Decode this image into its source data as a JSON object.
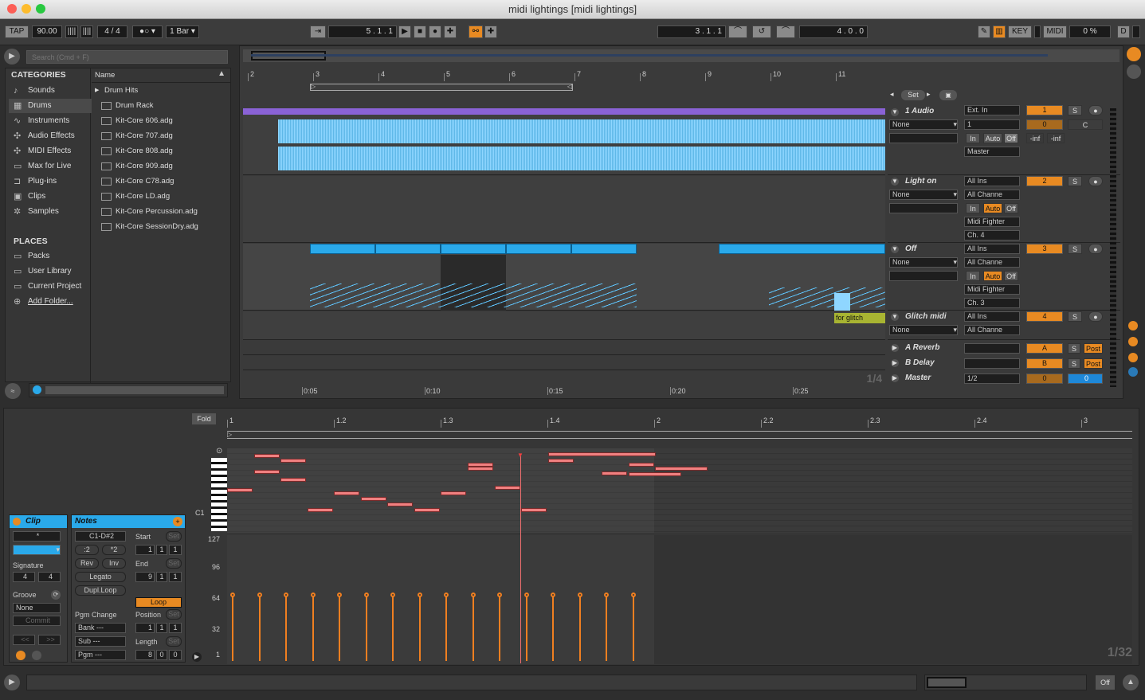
{
  "window": {
    "title": "midi lightings  [midi lightings]"
  },
  "toolbar": {
    "tap": "TAP",
    "tempo": "90.00",
    "sig_num": "4",
    "sig_sep": "/",
    "sig_den": "4",
    "quant": "1 Bar",
    "position": "5 .   1 .   1",
    "loop_start": "3 .   1 .   1",
    "loop_length": "4 .   0 .   0",
    "key": "KEY",
    "midi": "MIDI",
    "cpu": "0 %",
    "d": "D"
  },
  "browser": {
    "search_placeholder": "Search (Cmd + F)",
    "categories_title": "CATEGORIES",
    "categories": [
      {
        "label": "Sounds",
        "icon": "note-icon"
      },
      {
        "label": "Drums",
        "icon": "grid-icon"
      },
      {
        "label": "Instruments",
        "icon": "wave-icon"
      },
      {
        "label": "Audio Effects",
        "icon": "effect-icon"
      },
      {
        "label": "MIDI Effects",
        "icon": "midi-effect-icon"
      },
      {
        "label": "Max for Live",
        "icon": "max-icon"
      },
      {
        "label": "Plug-ins",
        "icon": "plugin-icon"
      },
      {
        "label": "Clips",
        "icon": "clip-icon"
      },
      {
        "label": "Samples",
        "icon": "sample-icon"
      }
    ],
    "places_title": "PLACES",
    "places": [
      {
        "label": "Packs"
      },
      {
        "label": "User Library"
      },
      {
        "label": "Current Project"
      },
      {
        "label": "Add Folder..."
      }
    ],
    "name_header": "Name",
    "parent_folder": "Drum Hits",
    "files": [
      "Drum Rack",
      "Kit-Core 606.adg",
      "Kit-Core 707.adg",
      "Kit-Core 808.adg",
      "Kit-Core 909.adg",
      "Kit-Core C78.adg",
      "Kit-Core LD.adg",
      "Kit-Core Percussion.adg",
      "Kit-Core SessionDry.adg"
    ]
  },
  "arrangement": {
    "bars": [
      "2",
      "3",
      "4",
      "5",
      "6",
      "7",
      "8",
      "9",
      "10",
      "11"
    ],
    "times": [
      "0:05",
      "0:10",
      "0:15",
      "0:20",
      "0:25"
    ],
    "set_label": "Set",
    "zoom": "1/4",
    "tracks": [
      {
        "name": "1 Audio",
        "in": "Ext. In",
        "in_ch": "1",
        "mon": [
          "In",
          "Auto",
          "Off"
        ],
        "out": "Master",
        "num": "1",
        "vol": "0",
        "pan": "C",
        "inf1": "-inf",
        "inf2": "-inf",
        "from": "None"
      },
      {
        "name": "Light on",
        "in": "All Ins",
        "in_ch": "All Channe",
        "mon": [
          "In",
          "Auto",
          "Off"
        ],
        "out": "Midi Fighter",
        "out_ch": "Ch. 4",
        "num": "2",
        "from": "None"
      },
      {
        "name": "Off",
        "in": "All Ins",
        "in_ch": "All Channe",
        "mon": [
          "In",
          "Auto",
          "Off"
        ],
        "out": "Midi Fighter",
        "out_ch": "Ch. 3",
        "num": "3",
        "from": "None"
      },
      {
        "name": "Glitch midi",
        "in": "All Ins",
        "in_ch": "All Channe",
        "num": "4",
        "from": "None",
        "clip": "for glitch"
      }
    ],
    "returns": [
      {
        "name": "A Reverb",
        "letter": "A",
        "post": "Post"
      },
      {
        "name": "B Delay",
        "letter": "B",
        "post": "Post"
      },
      {
        "name": "Master",
        "out": "1/2",
        "vol": "0",
        "pan": "0"
      }
    ],
    "solo": "S"
  },
  "clip_view": {
    "clip_title": "Clip",
    "notes_title": "Notes",
    "clip_name": "*",
    "signature_label": "Signature",
    "sig_num": "4",
    "sig_den": "4",
    "groove_label": "Groove",
    "groove_value": "None",
    "commit": "Commit",
    "pitch_range": "C1-D#2",
    "div2": ":2",
    "mul2": "*2",
    "rev": "Rev",
    "inv": "Inv",
    "legato": "Legato",
    "dupl": "Dupl.Loop",
    "pgm_change": "Pgm Change",
    "bank": "Bank ---",
    "sub": "Sub ---",
    "pgm": "Pgm ---",
    "start_label": "Start",
    "start": [
      "1",
      "1",
      "1"
    ],
    "end_label": "End",
    "end": [
      "9",
      "1",
      "1"
    ],
    "loop": "Loop",
    "position_label": "Position",
    "position": [
      "1",
      "1",
      "1"
    ],
    "length_label": "Length",
    "length": [
      "8",
      "0",
      "0"
    ],
    "set": "Set",
    "fold": "Fold",
    "ruler": [
      "1",
      "1.2",
      "1.3",
      "1.4",
      "2",
      "2.2",
      "2.3",
      "2.4",
      "3"
    ],
    "c1": "C1",
    "vel_labels": [
      "127",
      "96",
      "64",
      "32",
      "1"
    ],
    "zoom": "1/32"
  },
  "statusbar": {
    "off": "Off"
  }
}
